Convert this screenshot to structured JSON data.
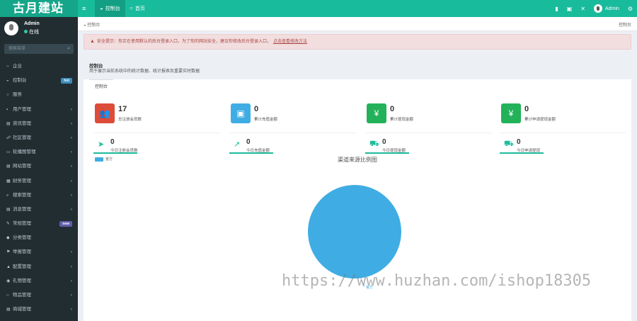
{
  "logo": "古月建站",
  "topbar": {
    "tabs": [
      {
        "label": "控制台",
        "icon": "dashboard-icon",
        "active": true
      },
      {
        "label": "首页",
        "icon": "home-icon",
        "active": false
      }
    ],
    "admin": "Admin"
  },
  "sidebar": {
    "user_name": "Admin",
    "status": "在线",
    "search_placeholder": "搜索菜单",
    "items": [
      {
        "label": "企业",
        "icon": "circle-icon"
      },
      {
        "label": "控制台",
        "icon": "dashboard-icon",
        "badge": "hot"
      },
      {
        "label": "服务",
        "icon": "circle-icon"
      },
      {
        "label": "用户管理",
        "icon": "user-icon",
        "chevron": true
      },
      {
        "label": "资讯管理",
        "icon": "news-icon",
        "chevron": true
      },
      {
        "label": "社区管理",
        "icon": "community-icon",
        "chevron": true
      },
      {
        "label": "轮播图管理",
        "icon": "image-icon",
        "chevron": true
      },
      {
        "label": "网站管理",
        "icon": "site-icon",
        "chevron": true
      },
      {
        "label": "财务管理",
        "icon": "finance-icon",
        "chevron": true
      },
      {
        "label": "搜索管理",
        "icon": "search-icon",
        "chevron": true
      },
      {
        "label": "消息管理",
        "icon": "message-icon",
        "chevron": true
      },
      {
        "label": "常规管理",
        "icon": "gear-icon",
        "badge": "new"
      },
      {
        "label": "分类管理",
        "icon": "category-icon"
      },
      {
        "label": "举报管理",
        "icon": "report-icon",
        "chevron": true
      },
      {
        "label": "配置管理",
        "icon": "config-icon",
        "chevron": true
      },
      {
        "label": "礼物管理",
        "icon": "gift-icon",
        "chevron": true
      },
      {
        "label": "物品管理",
        "icon": "item-icon",
        "chevron": true
      },
      {
        "label": "商城管理",
        "icon": "shop-icon",
        "chevron": true
      }
    ]
  },
  "breadcrumb": {
    "left": "控制台",
    "right": "控制台"
  },
  "alert": {
    "text": "安全提示：你正在使用默认的后台登录入口，为了你的网站安全，建议你修改后台登录入口，",
    "link": "点击查看修改方法"
  },
  "panel": {
    "title": "控制台",
    "desc": "用于展示当前系统中的统计数据、统计报表及重要实时数据",
    "tab": "控制台"
  },
  "stats_row1": [
    {
      "value": "17",
      "label": "总注册会员数",
      "color": "#dd4b39",
      "icon": "users-icon"
    },
    {
      "value": "0",
      "label": "累计充值金额",
      "color": "#3fade3",
      "icon": "shopping-bag-icon"
    },
    {
      "value": "0",
      "label": "累计提现金额",
      "color": "#23b25a",
      "icon": "yen-icon"
    },
    {
      "value": "0",
      "label": "累计申请提现金额",
      "color": "#23b25a",
      "icon": "yen-icon"
    }
  ],
  "stats_row2": [
    {
      "value": "0",
      "label": "今日注册会员数",
      "icon": "rocket-icon"
    },
    {
      "value": "0",
      "label": "今日充值金额",
      "icon": "trend-icon"
    },
    {
      "value": "0",
      "label": "今日提现金额",
      "icon": "cart-icon"
    },
    {
      "value": "0",
      "label": "今日申请提现",
      "icon": "cart-icon"
    }
  ],
  "chart_data": {
    "type": "pie",
    "title": "渠道来源比例图",
    "legend": [
      "官方"
    ],
    "legend_position": "top-left",
    "categories": [
      "官方"
    ],
    "values": [
      17
    ],
    "colors": [
      "#3fade3"
    ]
  },
  "watermark": "https://www.huzhan.com/ishop18305"
}
